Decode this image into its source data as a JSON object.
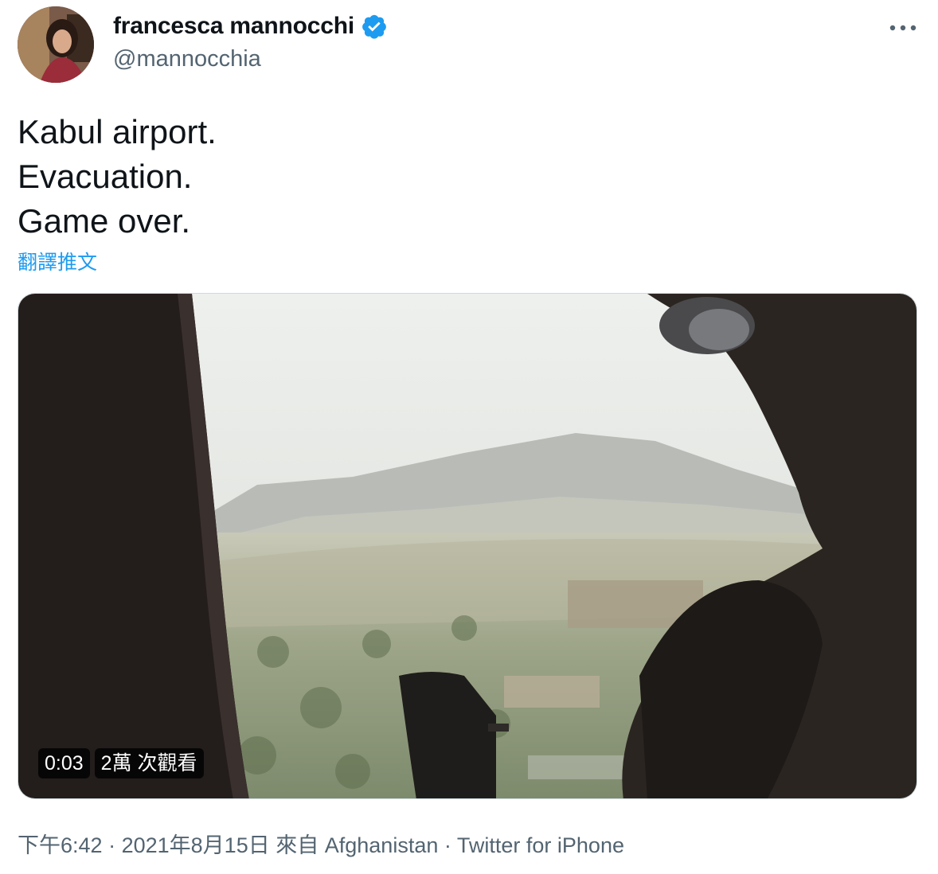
{
  "author": {
    "display_name": "francesca mannocchi",
    "handle": "@mannocchia",
    "avatar_icon": "avatar-photo",
    "verified_color": "#1d9bf0"
  },
  "tweet": {
    "lines": [
      "Kabul airport.",
      "Evacuation.",
      "Game over."
    ],
    "translate_label": "翻譯推文"
  },
  "media": {
    "type": "video",
    "duration": "0:03",
    "views": "2萬 次觀看"
  },
  "meta": {
    "time": "下午6:42",
    "separator": "·",
    "date": "2021年8月15日",
    "from_label": "來自",
    "location": "Afghanistan",
    "source": "Twitter for iPhone"
  },
  "colors": {
    "accent": "#1d9bf0",
    "text": "#0f1419",
    "secondary": "#536471"
  }
}
